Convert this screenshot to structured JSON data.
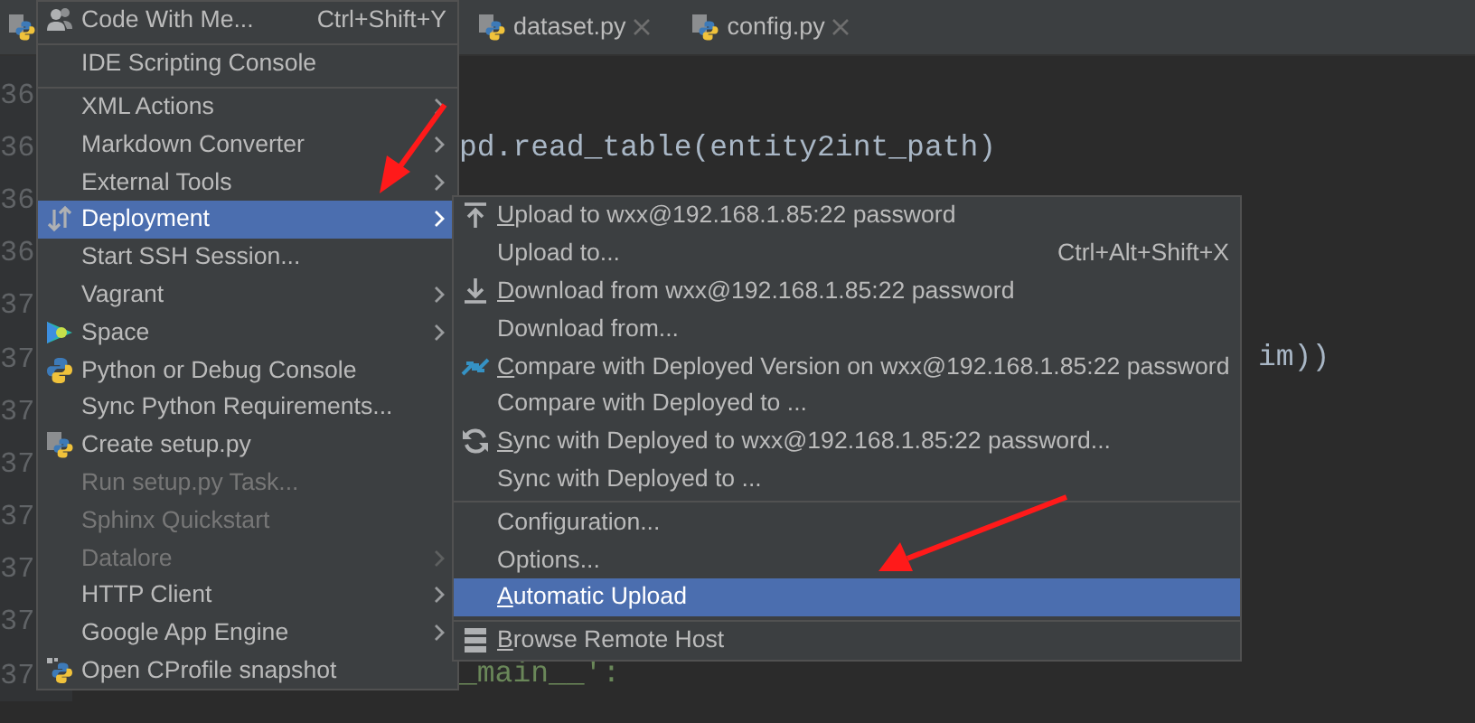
{
  "tabs": [
    {
      "label": "dataset.py"
    },
    {
      "label": "config.py"
    }
  ],
  "editor": {
    "lines": [
      {
        "number": "36"
      },
      {
        "number": "36",
        "text": "pd.read_table(entity2int_path)"
      },
      {
        "number": "36"
      },
      {
        "number": "36"
      },
      {
        "number": "37"
      },
      {
        "number": "37",
        "text": "im))",
        "kind": "tail"
      },
      {
        "number": "37"
      },
      {
        "number": "37"
      },
      {
        "number": "37"
      },
      {
        "number": "37"
      },
      {
        "number": "37"
      },
      {
        "number": "37",
        "text": "_main__':",
        "kind": "string"
      }
    ]
  },
  "main_menu": {
    "items": [
      {
        "label": "Code With Me...",
        "shortcut": "Ctrl+Shift+Y",
        "selected": false,
        "disabled": false,
        "submenu": false,
        "separator_before": false
      },
      {
        "label": "IDE Scripting Console",
        "selected": false,
        "disabled": false,
        "submenu": false,
        "separator_before": true
      },
      {
        "label": "XML Actions",
        "selected": false,
        "disabled": false,
        "submenu": true,
        "separator_before": true
      },
      {
        "label": "Markdown Converter",
        "selected": false,
        "disabled": false,
        "submenu": true,
        "separator_before": false
      },
      {
        "label": "External Tools",
        "selected": false,
        "disabled": false,
        "submenu": true,
        "separator_before": false
      },
      {
        "label": "Deployment",
        "selected": true,
        "disabled": false,
        "submenu": true,
        "separator_before": false
      },
      {
        "label": "Start SSH Session...",
        "selected": false,
        "disabled": false,
        "submenu": false,
        "separator_before": false
      },
      {
        "label": "Vagrant",
        "selected": false,
        "disabled": false,
        "submenu": true,
        "separator_before": false
      },
      {
        "label": "Space",
        "selected": false,
        "disabled": false,
        "submenu": true,
        "separator_before": false
      },
      {
        "label": "Python or Debug Console",
        "selected": false,
        "disabled": false,
        "submenu": false,
        "separator_before": false
      },
      {
        "label": "Sync Python Requirements...",
        "selected": false,
        "disabled": false,
        "submenu": false,
        "separator_before": false
      },
      {
        "label": "Create setup.py",
        "selected": false,
        "disabled": false,
        "submenu": false,
        "separator_before": false
      },
      {
        "label": "Run setup.py Task...",
        "selected": false,
        "disabled": true,
        "submenu": false,
        "separator_before": false
      },
      {
        "label": "Sphinx Quickstart",
        "selected": false,
        "disabled": true,
        "submenu": false,
        "separator_before": false
      },
      {
        "label": "Datalore",
        "selected": false,
        "disabled": true,
        "submenu": true,
        "separator_before": false
      },
      {
        "label": "HTTP Client",
        "selected": false,
        "disabled": false,
        "submenu": true,
        "separator_before": false
      },
      {
        "label": "Google App Engine",
        "selected": false,
        "disabled": false,
        "submenu": true,
        "separator_before": false
      },
      {
        "label": "Open CProfile snapshot",
        "selected": false,
        "disabled": false,
        "submenu": false,
        "separator_before": false
      }
    ]
  },
  "deployment_menu": {
    "items": [
      {
        "label": "Upload to wxx@192.168.1.85:22 password",
        "mnemonic": true,
        "selected": false,
        "separator_before": false
      },
      {
        "label": "Upload to...",
        "shortcut": "Ctrl+Alt+Shift+X",
        "mnemonic": false,
        "selected": false,
        "separator_before": false
      },
      {
        "label": "Download from wxx@192.168.1.85:22 password",
        "mnemonic": true,
        "selected": false,
        "separator_before": false
      },
      {
        "label": "Download from...",
        "mnemonic": false,
        "selected": false,
        "separator_before": false
      },
      {
        "label": "Compare with Deployed Version on wxx@192.168.1.85:22 password",
        "mnemonic": true,
        "selected": false,
        "separator_before": false
      },
      {
        "label": "Compare with Deployed to ...",
        "mnemonic": false,
        "selected": false,
        "separator_before": false
      },
      {
        "label": "Sync with Deployed to wxx@192.168.1.85:22 password...",
        "mnemonic": true,
        "selected": false,
        "separator_before": false
      },
      {
        "label": "Sync with Deployed to ...",
        "mnemonic": false,
        "selected": false,
        "separator_before": false
      },
      {
        "label": "Configuration...",
        "mnemonic": false,
        "selected": false,
        "separator_before": true
      },
      {
        "label": "Options...",
        "mnemonic": false,
        "selected": false,
        "separator_before": false
      },
      {
        "label": "Automatic Upload",
        "mnemonic": true,
        "selected": true,
        "separator_before": false
      },
      {
        "label": "Browse Remote Host",
        "mnemonic": true,
        "selected": false,
        "separator_before": true
      }
    ]
  }
}
